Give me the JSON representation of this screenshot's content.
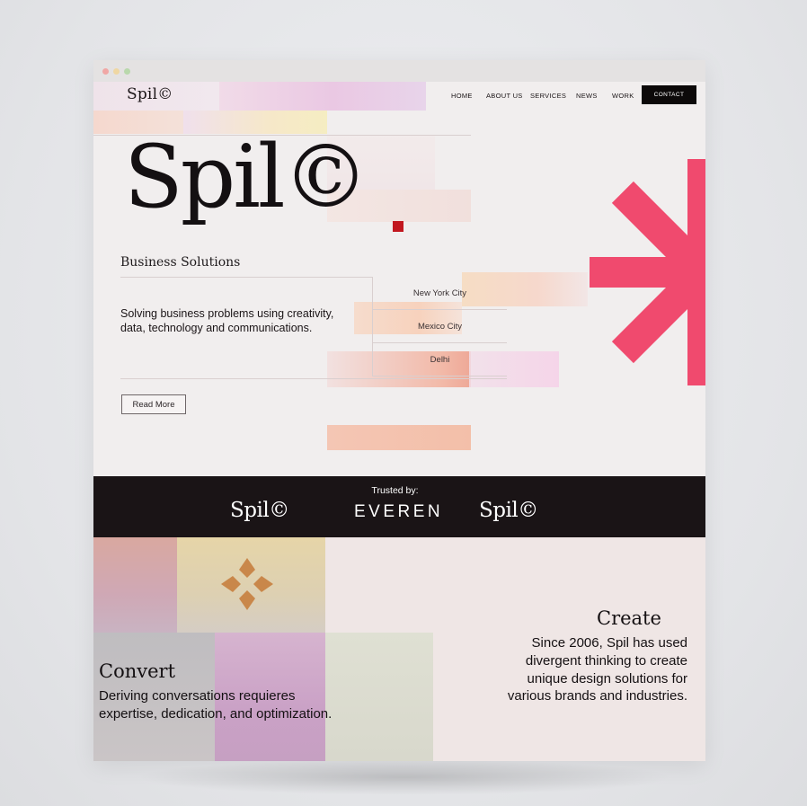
{
  "nav": {
    "logo": "Spil©",
    "items": [
      "HOME",
      "ABOUT US",
      "SERVICES",
      "NEWS",
      "WORK"
    ],
    "contact": "CONTACT"
  },
  "hero": {
    "title": "Spil©",
    "subtitle": "Business Solutions",
    "tagline": "Solving business problems using creativity, data, technology and communications.",
    "cities": [
      "New York City",
      "Mexico City",
      "Delhi"
    ],
    "read_more": "Read More"
  },
  "trusted": {
    "label": "Trusted by:",
    "logos": [
      "Spil©",
      "EVEREN",
      "Spil©"
    ]
  },
  "convert": {
    "heading": "Convert",
    "text": "Deriving conversations requieres expertise, dedication, and optimization."
  },
  "create": {
    "heading": "Create",
    "text": "Since 2006, Spil has used divergent thinking to create unique design solutions for various brands and industries."
  },
  "colors": {
    "accent_pink": "#f04a6e",
    "accent_red": "#c2171f",
    "dark": "#1a1416",
    "diamond": "#c9874a"
  },
  "icons": {
    "asterisk": "asterisk-icon",
    "diamond_star": "diamond-star-icon"
  }
}
